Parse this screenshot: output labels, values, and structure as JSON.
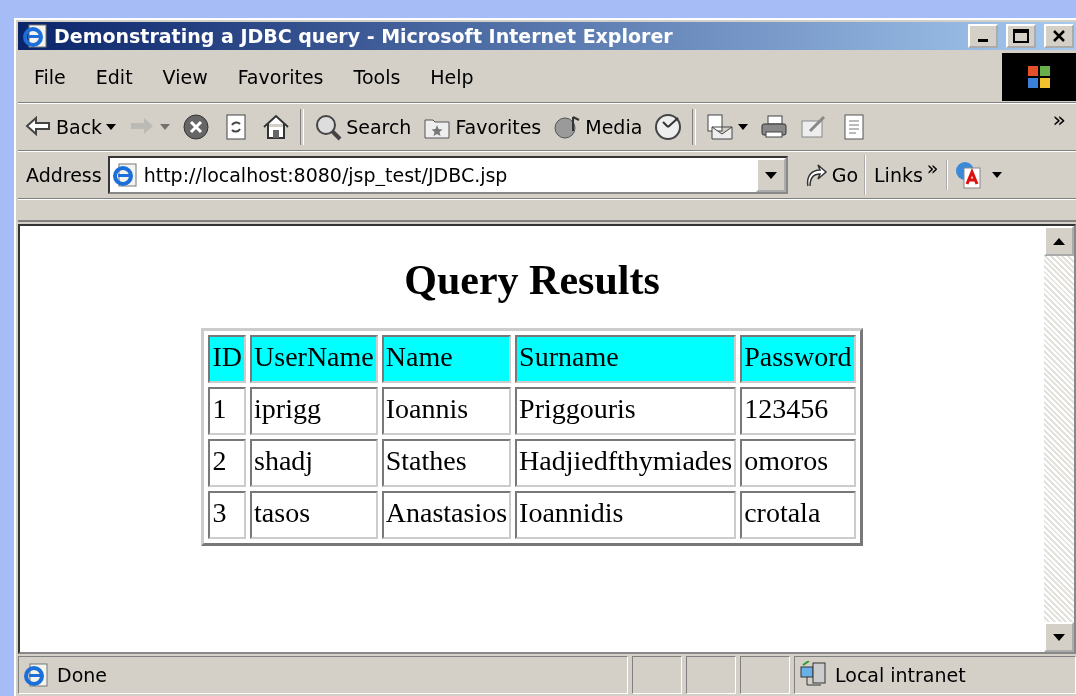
{
  "window": {
    "title": "Demonstrating a JDBC query - Microsoft Internet Explorer"
  },
  "menu": [
    "File",
    "Edit",
    "View",
    "Favorites",
    "Tools",
    "Help"
  ],
  "toolbar": [
    {
      "kind": "back",
      "label": "Back",
      "disabled": false,
      "has_menu": true
    },
    {
      "kind": "forward",
      "disabled": true,
      "has_menu": true
    },
    {
      "kind": "stop",
      "disabled": false,
      "has_menu": false
    },
    {
      "kind": "refresh",
      "disabled": false,
      "has_menu": false
    },
    {
      "kind": "home",
      "disabled": false,
      "has_menu": false
    },
    {
      "kind": "separator"
    },
    {
      "kind": "search",
      "label": "Search",
      "disabled": false,
      "has_menu": false
    },
    {
      "kind": "favorites",
      "label": "Favorites",
      "disabled": false,
      "has_menu": false
    },
    {
      "kind": "media",
      "label": "Media",
      "disabled": false,
      "has_menu": false
    },
    {
      "kind": "history",
      "disabled": false,
      "has_menu": false
    },
    {
      "kind": "separator"
    },
    {
      "kind": "mail",
      "disabled": false,
      "has_menu": true
    },
    {
      "kind": "print",
      "disabled": false,
      "has_menu": false
    },
    {
      "kind": "edit",
      "disabled": false,
      "has_menu": false
    },
    {
      "kind": "discuss",
      "disabled": false,
      "has_menu": false
    }
  ],
  "toolbar_overflow": "»",
  "address": {
    "label": "Address",
    "value": "http://localhost:8080/jsp_test/JDBC.jsp",
    "go": "Go"
  },
  "links": {
    "label": "Links",
    "overflow": "»"
  },
  "page": {
    "heading": "Query Results",
    "table": {
      "columns": [
        "ID",
        "UserName",
        "Name",
        "Surname",
        "Password"
      ],
      "rows": [
        [
          "1",
          "iprigg",
          "Ioannis",
          "Priggouris",
          "123456"
        ],
        [
          "2",
          "shadj",
          "Stathes",
          "Hadjiedfthymiades",
          "omoros"
        ],
        [
          "3",
          "tasos",
          "Anastasios",
          "Ioannidis",
          "crotala"
        ]
      ]
    }
  },
  "status_bar": {
    "text": "Done",
    "zone": "Local intranet"
  }
}
